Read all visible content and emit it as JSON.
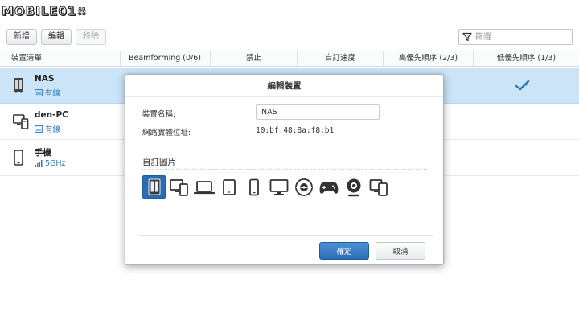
{
  "logo": {
    "text": "MOBILE01",
    "suffix": "器"
  },
  "toolbar": {
    "add_label": "新增",
    "edit_label": "編輯",
    "remove_label": "移除"
  },
  "filter": {
    "placeholder": "篩選",
    "icon": "filter-icon"
  },
  "table": {
    "headers": [
      "裝置清單",
      "Beamforming (0/6)",
      "禁止",
      "自訂速度",
      "高優先順序 (2/3)",
      "低優先順序 (1/3)"
    ],
    "rows": [
      {
        "name": "NAS",
        "connection": "有線",
        "icon": "nas-icon",
        "conn_icon": "wired-icon",
        "selected": true,
        "low_priority_icon": "check-icon"
      },
      {
        "name": "den-PC",
        "connection": "有線",
        "icon": "pc-icon",
        "conn_icon": "wired-icon",
        "selected": false
      },
      {
        "name": "手機",
        "connection": "5GHz",
        "icon": "phone-icon",
        "conn_icon": "wifi-signal-icon",
        "selected": false
      }
    ]
  },
  "dialog": {
    "title": "編輯裝置",
    "device_name_label": "裝置名稱:",
    "device_name_value": "NAS",
    "mac_label": "網路實體位址:",
    "mac_value": "10:bf:48:8a:f8:b1",
    "custom_icon_label": "自訂圖片",
    "icons": [
      "nas-icon",
      "pc-icon",
      "laptop-icon",
      "tablet-icon",
      "phone-icon",
      "monitor-icon",
      "media-player-icon",
      "gamepad-icon",
      "webcam-icon",
      "multi-device-icon"
    ],
    "selected_icon": "nas-icon",
    "ok_label": "確定",
    "cancel_label": "取消"
  },
  "colors": {
    "accent": "#2c6cb3",
    "row_selected": "#cce4f7",
    "link": "#2b79b8"
  }
}
